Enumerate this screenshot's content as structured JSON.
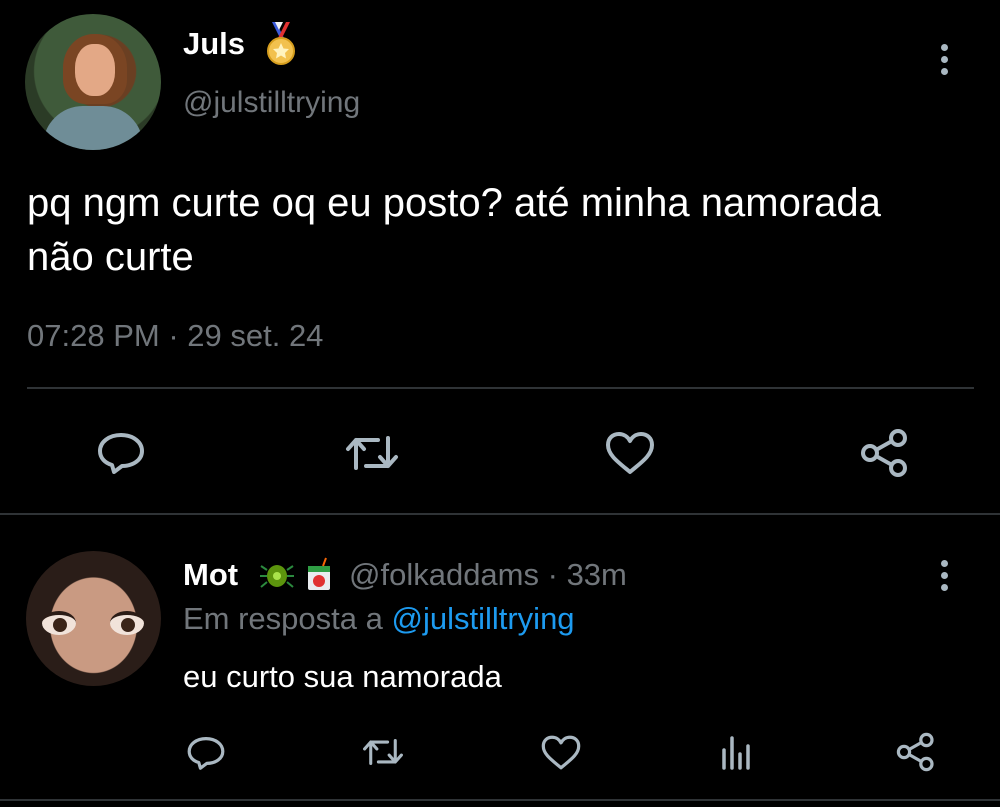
{
  "tweet": {
    "author_name": "Juls",
    "author_badge": "medal-emoji",
    "handle": "@julstilltrying",
    "text": "pq ngm curte oq eu posto? até minha namorada não curte",
    "time": "07:28 PM",
    "date": "29 set. 24",
    "meta_separator": " · ",
    "actions": [
      "reply-icon",
      "retweet-icon",
      "like-icon",
      "share-icon"
    ]
  },
  "reply": {
    "author_name": "Mot",
    "author_badges": [
      "bug-emoji",
      "juice-box-emoji"
    ],
    "handle": "@folkaddams",
    "time_ago": "33m",
    "separator": " · ",
    "reply_prefix": "Em resposta a ",
    "reply_to": "@julstilltrying",
    "text": "eu curto sua namorada",
    "actions": [
      "reply-icon",
      "retweet-icon",
      "like-icon",
      "views-icon",
      "share-icon"
    ]
  },
  "colors": {
    "background": "#000000",
    "text": "#ffffff",
    "muted": "#71767b",
    "link": "#1d9bf0",
    "icon": "#aab8c2",
    "divider": "#2f3336"
  }
}
